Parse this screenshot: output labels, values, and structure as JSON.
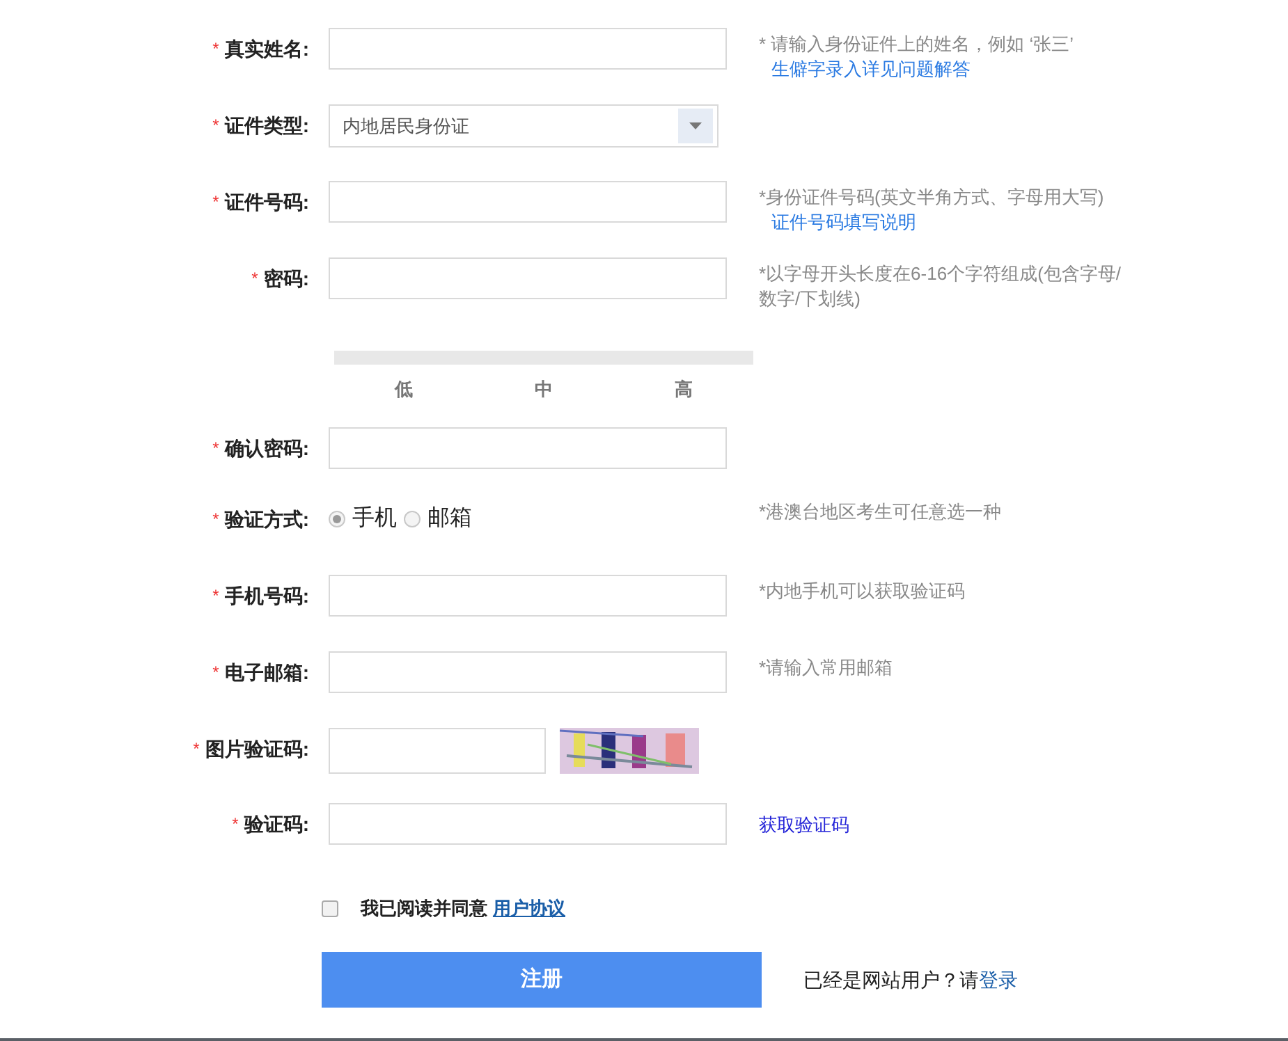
{
  "fields": [
    {
      "kind": "text",
      "label": "真实姓名:",
      "required_mark": "*",
      "hint": "* 请输入身份证件上的姓名，例如 ‘张三’",
      "hint_link": "生僻字录入详见问题解答"
    },
    {
      "kind": "select",
      "label": "证件类型:",
      "required_mark": "*",
      "value": "内地居民身份证"
    },
    {
      "kind": "text",
      "label": "证件号码:",
      "required_mark": "*",
      "hint": "*身份证件号码(英文半角方式、字母用大写)",
      "hint_link": "证件号码填写说明"
    },
    {
      "kind": "password",
      "label": "密码:",
      "required_mark": "*",
      "hint": "*以字母开头长度在6-16个字符组成(包含字母/数字/下划线)",
      "strength_labels": [
        "低",
        "中",
        "高"
      ]
    },
    {
      "kind": "text",
      "label": "确认密码:",
      "required_mark": "*"
    },
    {
      "kind": "radio",
      "label": "验证方式:",
      "required_mark": "*",
      "options": [
        {
          "label": "手机",
          "selected": true
        },
        {
          "label": "邮箱",
          "selected": false
        }
      ],
      "hint": "*港澳台地区考生可任意选一种"
    },
    {
      "kind": "text",
      "label": "手机号码:",
      "required_mark": "*",
      "hint": "*内地手机可以获取验证码"
    },
    {
      "kind": "text",
      "label": "电子邮箱:",
      "required_mark": "*",
      "hint": "*请输入常用邮箱"
    },
    {
      "kind": "captcha",
      "label": "图片验证码:",
      "required_mark": "*"
    },
    {
      "kind": "text",
      "label": "验证码:",
      "required_mark": "*",
      "action_link": "获取验证码"
    }
  ],
  "agreement": {
    "checked": false,
    "text": "我已阅读并同意",
    "link": "用户协议"
  },
  "submit": "注册",
  "login_prompt": {
    "text": "已经是网站用户？请",
    "link": "登录"
  }
}
